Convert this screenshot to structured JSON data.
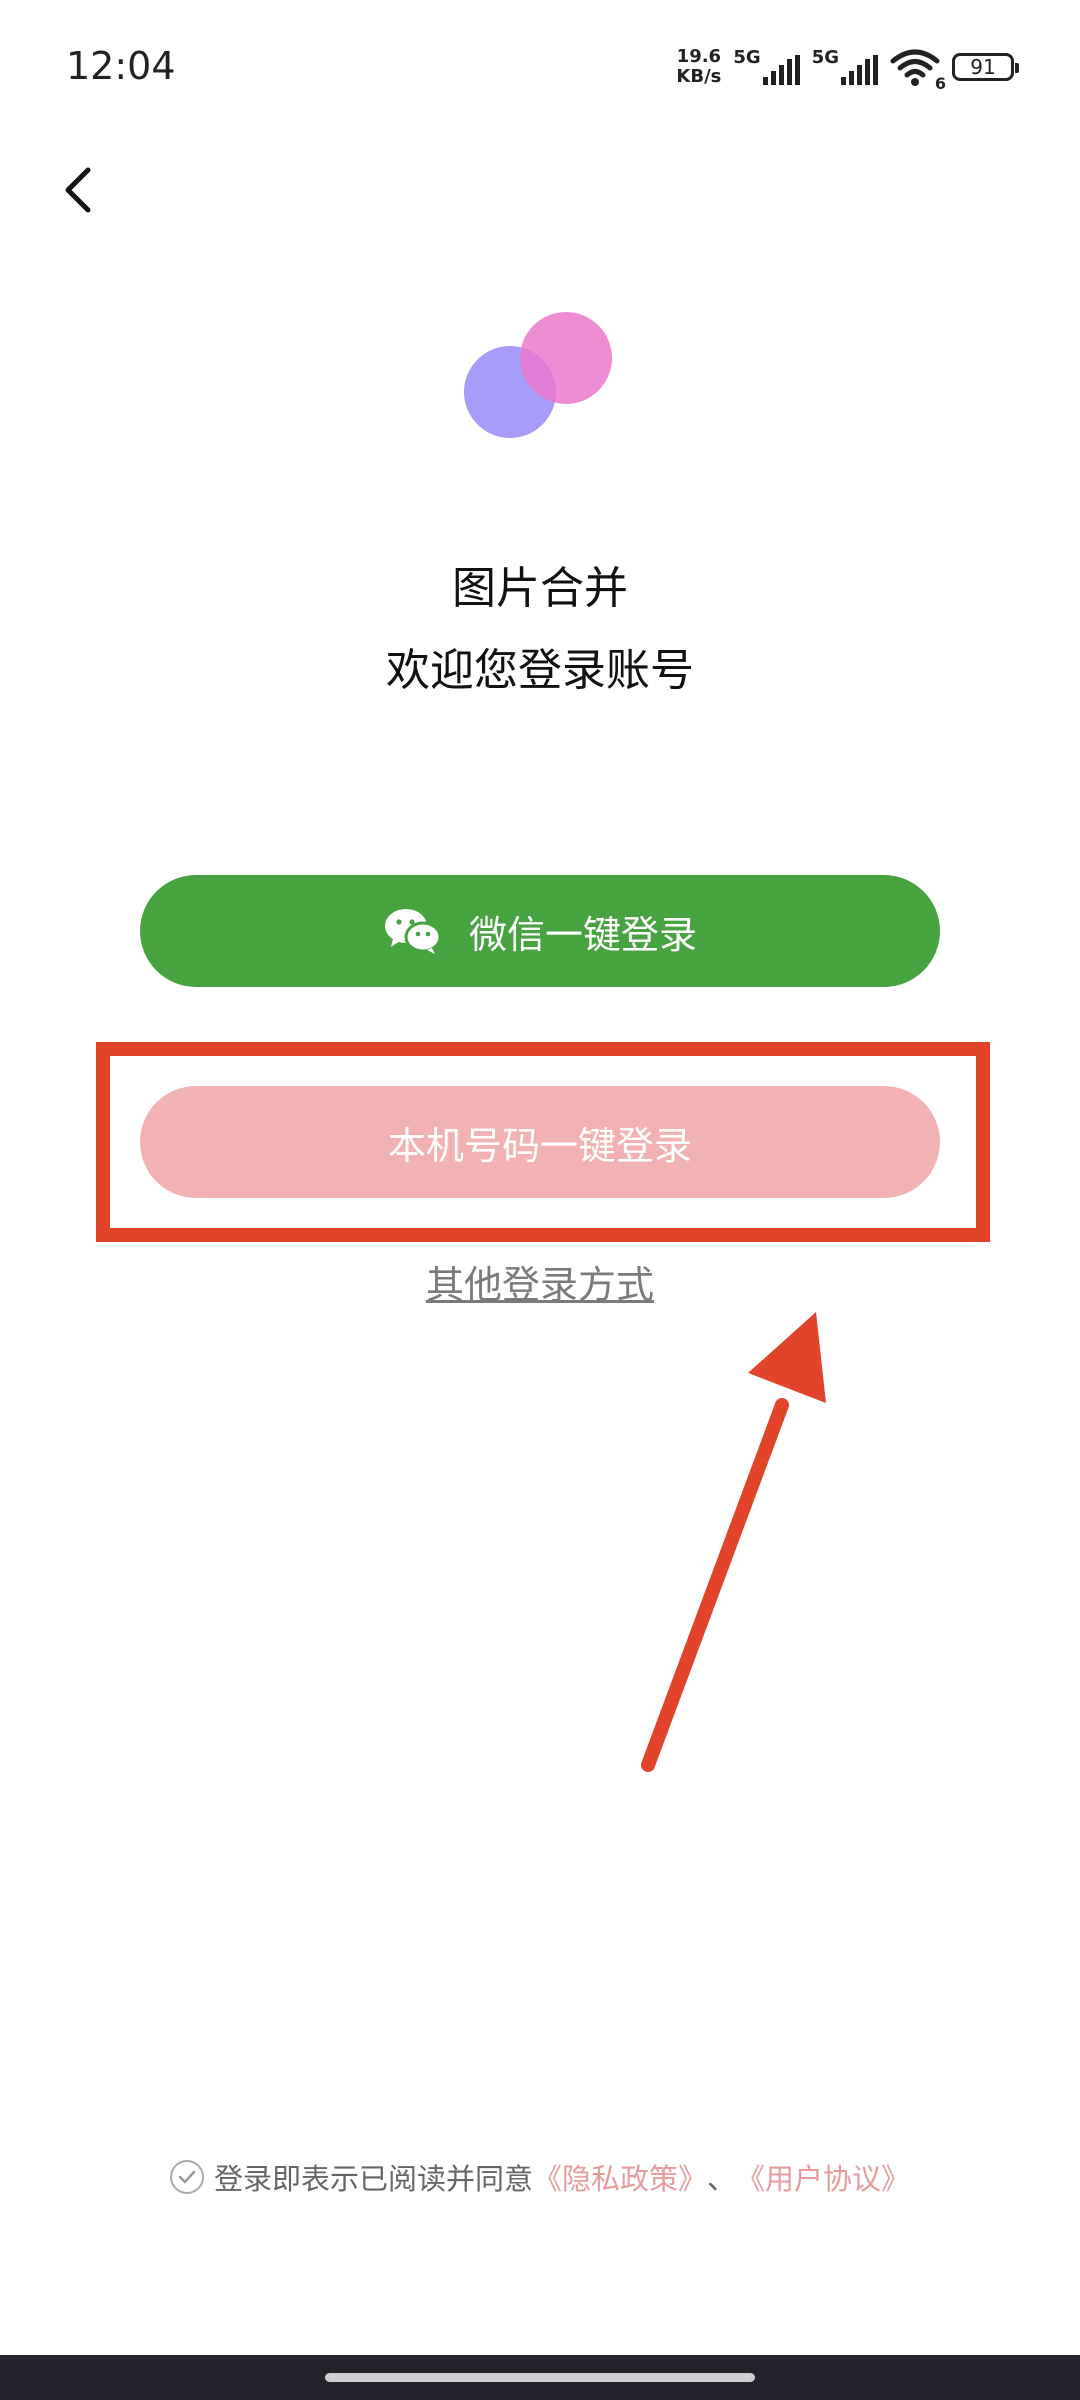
{
  "status_bar": {
    "time": "12:04",
    "speed_value": "19.6",
    "speed_unit": "KB/s",
    "sim1_label": "5G",
    "sim2_label": "5G",
    "wifi_badge": "6",
    "battery": "91"
  },
  "header": {
    "back_icon": "chevron-left-icon"
  },
  "app": {
    "name": "图片合并",
    "welcome": "欢迎您登录账号",
    "logo_colors": [
      "#968cfa",
      "#eb78cd"
    ]
  },
  "login": {
    "wechat_label": "微信一键登录",
    "wechat_icon": "wechat-icon",
    "phone_label": "本机号码一键登录",
    "other_label": "其他登录方式"
  },
  "terms": {
    "text": "登录即表示已阅读并同意",
    "privacy_link": "《隐私政策》",
    "separator": "、",
    "agreement_link": "《用户协议》"
  },
  "colors": {
    "wechat_green": "#47a240",
    "phone_pink": "#f2b1b2",
    "annotation_red": "#e2432b",
    "link_pink": "#e79b9c"
  }
}
